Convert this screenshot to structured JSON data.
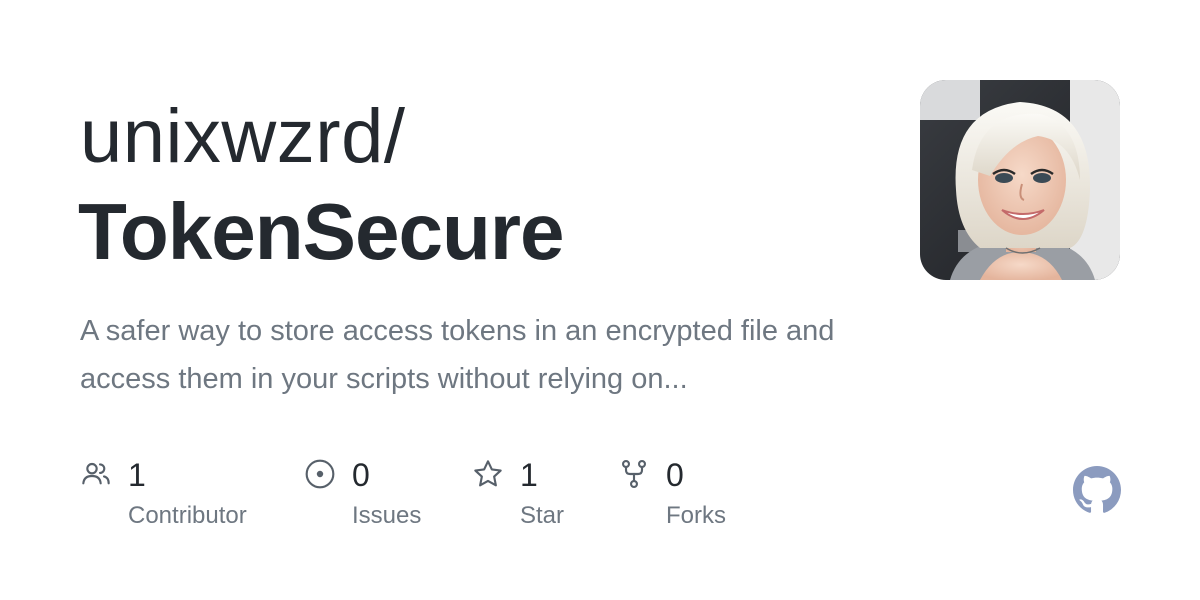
{
  "repo": {
    "owner": "unixwzrd/",
    "name": "TokenSecure",
    "description": "A safer way to store access tokens in an encrypted file and access them in your scripts without relying on..."
  },
  "avatar": {
    "icon": "user-avatar"
  },
  "stats": {
    "contributors": {
      "count": "1",
      "label": "Contributor",
      "icon": "people-icon"
    },
    "issues": {
      "count": "0",
      "label": "Issues",
      "icon": "issue-opened-icon"
    },
    "stars": {
      "count": "1",
      "label": "Star",
      "icon": "star-icon"
    },
    "forks": {
      "count": "0",
      "label": "Forks",
      "icon": "repo-forked-icon"
    }
  },
  "branding": {
    "icon": "github-mark-icon",
    "color": "#8b9bbf"
  },
  "colors": {
    "title": "#24292f",
    "muted": "#6e7781",
    "icon": "#57606a"
  }
}
